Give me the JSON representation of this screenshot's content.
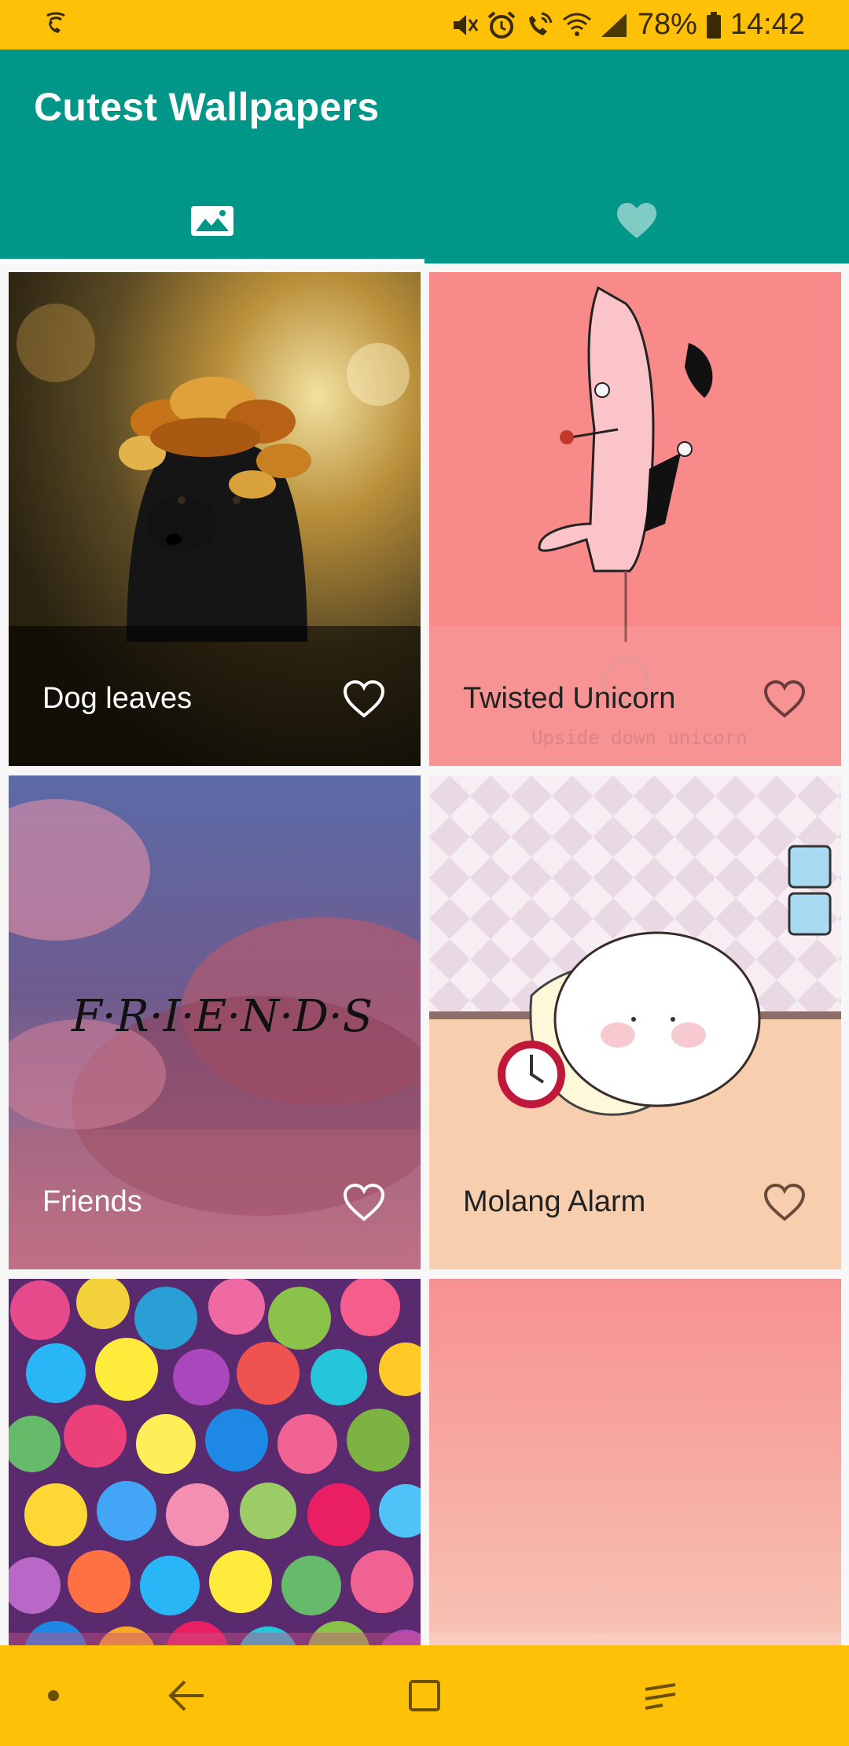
{
  "status_bar": {
    "battery": "78%",
    "time": "14:42"
  },
  "app": {
    "title": "Cutest Wallpapers"
  },
  "tabs": [
    {
      "icon": "image-icon",
      "selected": true
    },
    {
      "icon": "heart-icon",
      "selected": false
    }
  ],
  "colors": {
    "status_bar": "#FFC107",
    "app_bar": "#009688",
    "nav_bar": "#FFC107"
  },
  "wallpapers": [
    {
      "title": "Dog leaves",
      "favorite": false
    },
    {
      "title": "Twisted Unicorn",
      "favorite": false,
      "image_text": "Upside down unicorn"
    },
    {
      "title": "Friends",
      "favorite": false,
      "image_text": "F·R·I·E·N·D·S"
    },
    {
      "title": "Molang Alarm",
      "favorite": false
    },
    {
      "title": "",
      "favorite": false
    },
    {
      "title": "",
      "favorite": false
    }
  ]
}
